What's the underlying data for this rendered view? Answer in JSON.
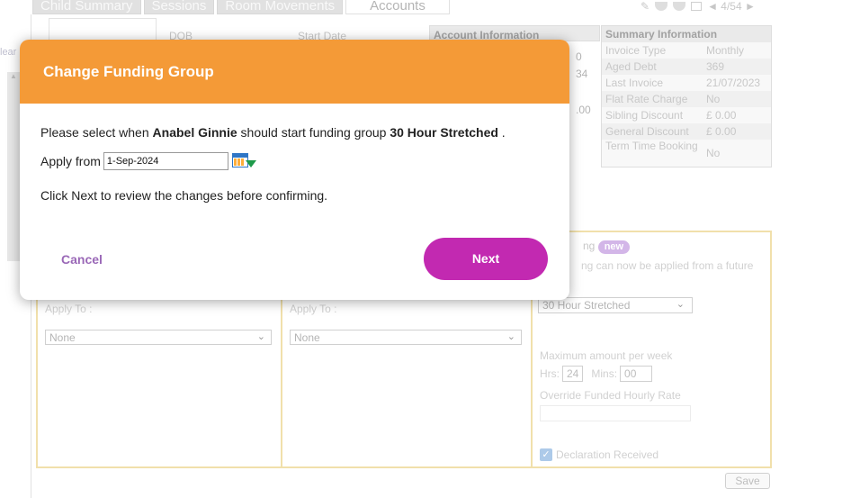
{
  "background": {
    "left": {
      "clear_label": "lear"
    },
    "tabs": [
      {
        "label": "Child Summary"
      },
      {
        "label": "Sessions"
      },
      {
        "label": "Room Movements"
      },
      {
        "label": "Accounts"
      }
    ],
    "toolbar": {
      "nav_text": "◄ 4/54 ►"
    },
    "top_labels": {
      "dob": "DOB",
      "start_date": "Start Date"
    },
    "account_information": {
      "title": "Account Information",
      "values": [
        "0",
        "34",
        ".00"
      ]
    },
    "summary_information": {
      "title": "Summary Information",
      "rows": [
        {
          "key": "Invoice Type",
          "value": "Monthly"
        },
        {
          "key": "Aged Debt",
          "value": "369"
        },
        {
          "key": "Last Invoice",
          "value": "21/07/2023"
        },
        {
          "key": "Flat Rate Charge",
          "value": "No"
        },
        {
          "key": "Sibling Discount",
          "value": "£ 0.00"
        },
        {
          "key": "General Discount",
          "value": "£ 0.00"
        },
        {
          "key": "Term Time Booking",
          "value": "No"
        }
      ]
    },
    "panel": {
      "col1": {
        "apply_to_label": "Apply To :",
        "select_value": "None"
      },
      "col2": {
        "apply_to_label": "Apply To :",
        "select_value": "None"
      },
      "funding": {
        "title_suffix": "ng",
        "new_badge": "new",
        "description": "ng can now be applied from a future",
        "group_select": "30 Hour Stretched",
        "max_label": "Maximum amount per week",
        "hrs_label": "Hrs:",
        "hrs_value": "24",
        "mins_label": "Mins:",
        "mins_value": "00",
        "override_label": "Override Funded Hourly Rate",
        "declaration_label": "Declaration Received"
      }
    },
    "save_label": "Save"
  },
  "modal": {
    "title": "Change Funding Group",
    "sentence": {
      "prefix": "Please select when ",
      "child_name": "Anabel Ginnie",
      "middle": " should start funding group ",
      "group_name": "30 Hour Stretched",
      "suffix": " ."
    },
    "apply_from_label": "Apply from",
    "apply_from_value": "1-Sep-2024",
    "review_text": "Click Next to review the changes before confirming.",
    "cancel_label": "Cancel",
    "next_label": "Next"
  },
  "colors": {
    "modal_header": "#f49a37",
    "next_button": "#c229b1",
    "cancel_text": "#9a68b7",
    "panel_border": "#e6c766"
  }
}
